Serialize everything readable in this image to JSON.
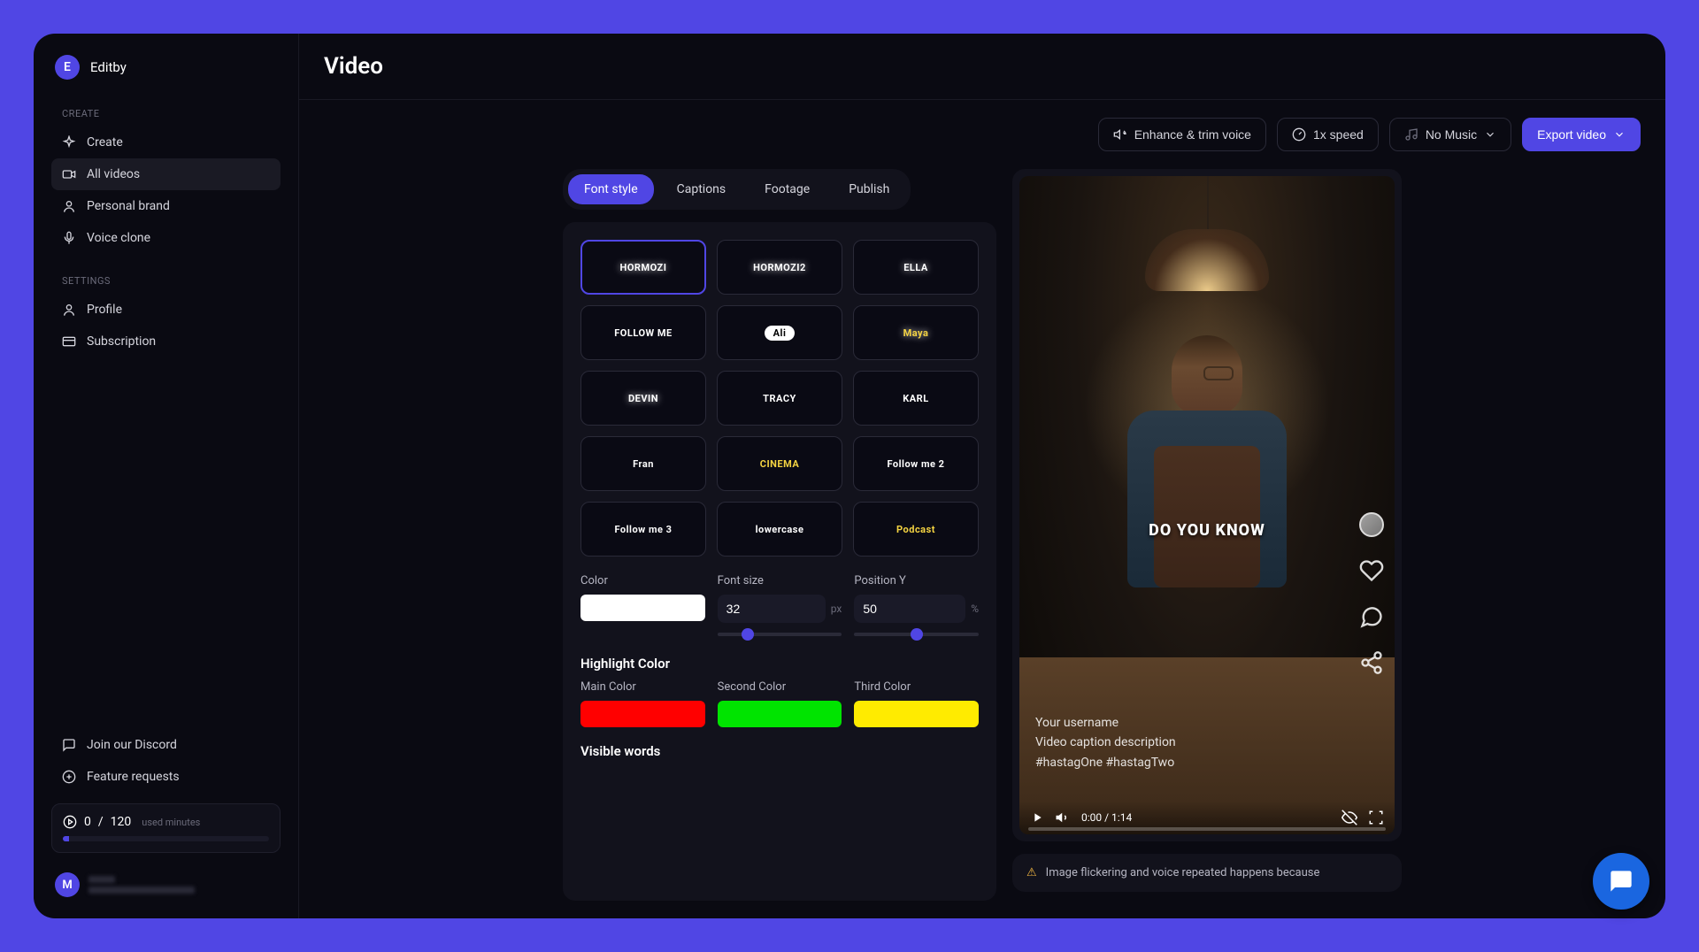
{
  "brand": {
    "initial": "E",
    "name": "Editby"
  },
  "sidebar": {
    "createLabel": "CREATE",
    "settingsLabel": "SETTINGS",
    "items": {
      "create": "Create",
      "allVideos": "All videos",
      "personalBrand": "Personal brand",
      "voiceClone": "Voice clone",
      "profile": "Profile",
      "subscription": "Subscription",
      "discord": "Join our Discord",
      "feature": "Feature requests"
    }
  },
  "usage": {
    "used": "0",
    "sep": " / ",
    "total": "120",
    "label": "used minutes"
  },
  "user": {
    "initial": "M"
  },
  "page": {
    "title": "Video"
  },
  "toolbar": {
    "enhance": "Enhance & trim voice",
    "speed": "1x speed",
    "music": "No Music",
    "export": "Export video"
  },
  "tabs": {
    "fontStyle": "Font style",
    "captions": "Captions",
    "footage": "Footage",
    "publish": "Publish"
  },
  "styles": [
    {
      "label": "HORMOZI",
      "class": "glow",
      "selected": true
    },
    {
      "label": "HORMOZI2",
      "class": "glow"
    },
    {
      "label": "ELLA",
      "class": "glow"
    },
    {
      "label": "FOLLOW ME",
      "class": ""
    },
    {
      "label": "Ali",
      "class": "pill"
    },
    {
      "label": "Maya",
      "class": "yellow glow"
    },
    {
      "label": "DEVIN",
      "class": "glow"
    },
    {
      "label": "TRACY",
      "class": ""
    },
    {
      "label": "KARL",
      "class": ""
    },
    {
      "label": "Fran",
      "class": ""
    },
    {
      "label": "CINEMA",
      "class": "yellow"
    },
    {
      "label": "Follow me 2",
      "class": ""
    },
    {
      "label": "Follow me 3",
      "class": ""
    },
    {
      "label": "lowercase",
      "class": ""
    },
    {
      "label": "Podcast",
      "class": "yellow"
    }
  ],
  "controls": {
    "colorLabel": "Color",
    "color": "#ffffff",
    "fontSizeLabel": "Font size",
    "fontSize": "32",
    "fontSizeUnit": "px",
    "posYLabel": "Position Y",
    "posY": "50",
    "posYUnit": "%"
  },
  "highlight": {
    "title": "Highlight Color",
    "mainLabel": "Main Color",
    "mainColor": "#ff0000",
    "secondLabel": "Second Color",
    "secondColor": "#00e400",
    "thirdLabel": "Third Color",
    "thirdColor": "#ffeb00"
  },
  "visibleWords": {
    "title": "Visible words"
  },
  "preview": {
    "captionText": "DO YOU KNOW",
    "username": "Your username",
    "description": "Video caption description",
    "hashtags": "#hastagOne #hastagTwo",
    "time": "0:00 / 1:14"
  },
  "warning": {
    "text": "Image flickering and voice repeated happens because"
  }
}
